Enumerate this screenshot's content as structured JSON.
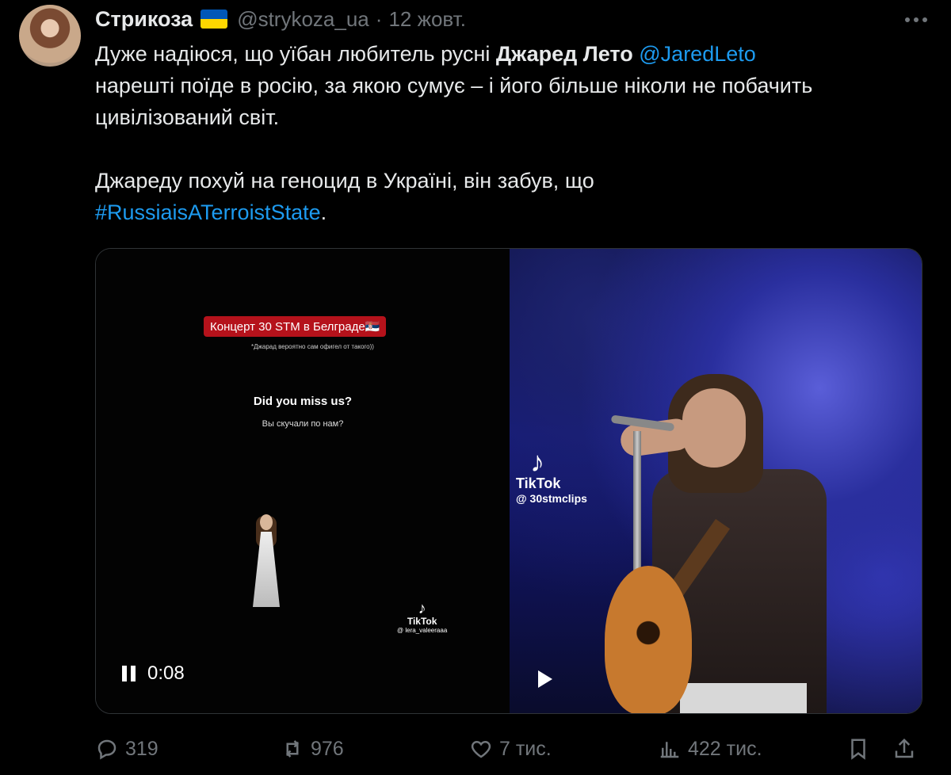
{
  "author": {
    "display_name": "Стрикоза",
    "flag_icon": "ukraine-flag-icon",
    "handle": "@strykoza_ua",
    "separator": "·",
    "date": "12 жовт."
  },
  "tweet": {
    "line1_a": "Дуже надіюся, що уїбан любитель русні ",
    "line1_bold": "Джаред Лето",
    "line1_space": " ",
    "line1_mention": "@JaredLeto",
    "line2": "нарешті поїде в росію, за якою сумує – і його більше ніколи не побачить",
    "line3": "цивілізований світ.",
    "line4": "Джареду похуй на геноцид в Україні, він забув, що",
    "hashtag": "#RussiaisATerroistState",
    "end": "."
  },
  "media": {
    "left": {
      "tag": "Концерт 30 STM в Белграде🇷🇸",
      "subtag": "*Джарад вероятно сам офигел от такого))",
      "question_en": "Did you miss us?",
      "question_ru": "Вы скучали по нам?",
      "tiktok_label": "TikTok",
      "tiktok_user": "@ lera_valeeraaa"
    },
    "right": {
      "tiktok_label": "TikTok",
      "tiktok_user": "@ 30stmclips"
    },
    "time": "0:08"
  },
  "actions": {
    "replies": "319",
    "reposts": "976",
    "likes": "7 тис.",
    "views": "422 тис."
  },
  "colors": {
    "background": "#000000",
    "text": "#e7e9ea",
    "muted": "#71767b",
    "link": "#1d9bf0"
  }
}
